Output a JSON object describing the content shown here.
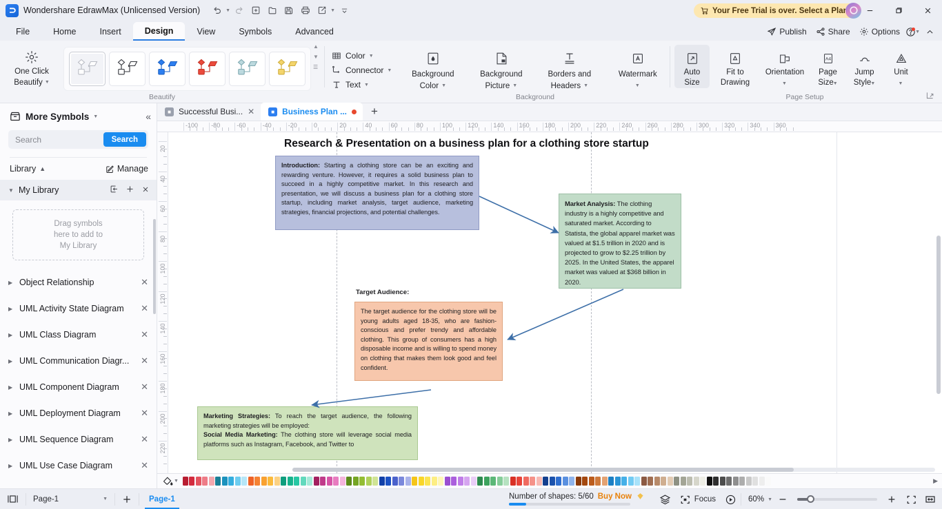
{
  "app": {
    "title": "Wondershare EdrawMax (Unlicensed Version)",
    "logo_glyph": "ɔ",
    "trial_banner": "Your Free Trial is over. Select a Plan"
  },
  "quick_access": [
    {
      "name": "undo",
      "icon": "undo-icon",
      "has_caret": true
    },
    {
      "name": "redo",
      "icon": "redo-icon",
      "has_caret": false
    },
    {
      "name": "new",
      "icon": "new-file-icon",
      "has_caret": false
    },
    {
      "name": "open",
      "icon": "folder-open-icon",
      "has_caret": false
    },
    {
      "name": "save",
      "icon": "save-icon",
      "has_caret": false
    },
    {
      "name": "print",
      "icon": "print-icon",
      "has_caret": false
    },
    {
      "name": "export",
      "icon": "export-icon",
      "has_caret": true
    },
    {
      "name": "more",
      "icon": "chevron-down-icon",
      "has_caret": false
    }
  ],
  "window_buttons": {
    "minimize": "–",
    "maximize": "❐",
    "close": "✕"
  },
  "menu": {
    "tabs": [
      {
        "label": "File",
        "active": false
      },
      {
        "label": "Home",
        "active": false
      },
      {
        "label": "Insert",
        "active": false
      },
      {
        "label": "Design",
        "active": true
      },
      {
        "label": "View",
        "active": false
      },
      {
        "label": "Symbols",
        "active": false
      },
      {
        "label": "Advanced",
        "active": false
      }
    ],
    "right_links": [
      {
        "label": "Publish",
        "icon": "publish-icon"
      },
      {
        "label": "Share",
        "icon": "share-icon"
      },
      {
        "label": "Options",
        "icon": "gear-icon"
      }
    ]
  },
  "ribbon": {
    "groups": [
      {
        "name": "beautify",
        "label": "Beautify"
      },
      {
        "name": "background",
        "label": "Background"
      },
      {
        "name": "page_setup",
        "label": "Page Setup"
      }
    ],
    "one_click_beautify": {
      "line1": "One Click",
      "line2": "Beautify"
    },
    "theme_swatches": [
      {
        "name": "theme-default",
        "selected": true,
        "fill": "#ffffff",
        "stroke": "#b9bcc4"
      },
      {
        "name": "theme-outline",
        "selected": false,
        "fill": "#ffffff",
        "stroke": "#33353b"
      },
      {
        "name": "theme-blue",
        "selected": false,
        "fill": "#2d7ff0",
        "stroke": "#1c62c4"
      },
      {
        "name": "theme-red",
        "selected": false,
        "fill": "#eb4b3c",
        "stroke": "#c43326"
      },
      {
        "name": "theme-teal",
        "selected": false,
        "fill": "#bcd9de",
        "stroke": "#7fa9b1"
      },
      {
        "name": "theme-yellow",
        "selected": false,
        "fill": "#f3d46b",
        "stroke": "#cfae3d"
      }
    ],
    "mini_items": [
      {
        "label": "Color",
        "icon": "color-grid-icon",
        "caret": true
      },
      {
        "label": "Connector",
        "icon": "connector-icon",
        "caret": true
      },
      {
        "label": "Text",
        "icon": "text-icon",
        "caret": true
      }
    ],
    "background_buttons": [
      {
        "l1": "Background",
        "l2": "Color",
        "icon": "paint-drop-icon",
        "caret": true
      },
      {
        "l1": "Background",
        "l2": "Picture",
        "icon": "picture-page-icon",
        "caret": true
      },
      {
        "l1": "Borders and",
        "l2": "Headers",
        "icon": "borders-headers-icon",
        "caret": true
      },
      {
        "l1": "Watermark",
        "l2": "",
        "icon": "watermark-icon",
        "caret": true
      }
    ],
    "page_setup_buttons": [
      {
        "l1": "Auto",
        "l2": "Size",
        "icon": "auto-size-icon",
        "caret": false,
        "selected": true
      },
      {
        "l1": "Fit to",
        "l2": "Drawing",
        "icon": "fit-to-drawing-icon",
        "caret": false,
        "selected": false
      },
      {
        "l1": "Orientation",
        "l2": "",
        "icon": "orientation-icon",
        "caret": true,
        "selected": false
      },
      {
        "l1": "Page",
        "l2": "Size",
        "icon": "page-size-icon",
        "caret": true,
        "selected": false
      },
      {
        "l1": "Jump",
        "l2": "Style",
        "icon": "jump-style-icon",
        "caret": true,
        "selected": false
      },
      {
        "l1": "Unit",
        "l2": "",
        "icon": "unit-icon",
        "caret": true,
        "selected": false
      }
    ]
  },
  "sidebar": {
    "title": "More Symbols",
    "search_placeholder": "Search",
    "search_value": "",
    "search_button": "Search",
    "library_label": "Library",
    "manage_label": "Manage",
    "my_library_label": "My Library",
    "dropzone": [
      "Drag symbols",
      "here to add to",
      "My Library"
    ],
    "items": [
      {
        "label": "Object Relationship"
      },
      {
        "label": "UML Activity State Diagram"
      },
      {
        "label": "UML Class Diagram"
      },
      {
        "label": "UML Communication Diagr..."
      },
      {
        "label": "UML Component Diagram"
      },
      {
        "label": "UML Deployment Diagram"
      },
      {
        "label": "UML Sequence Diagram"
      },
      {
        "label": "UML Use Case Diagram"
      }
    ]
  },
  "doc_tabs": [
    {
      "label": "Successful Busi...",
      "active": false,
      "modified": false
    },
    {
      "label": "Business Plan ...",
      "active": true,
      "modified": true
    }
  ],
  "rulers": {
    "horizontal": [
      "-100",
      "-80",
      "-60",
      "-40",
      "-20",
      "0",
      "20",
      "40",
      "60",
      "80",
      "100",
      "120",
      "140",
      "160",
      "180",
      "200",
      "220",
      "240",
      "260",
      "280",
      "300",
      "320",
      "340",
      "360"
    ],
    "vertical": [
      "20",
      "40",
      "60",
      "80",
      "100",
      "120",
      "140",
      "160",
      "180",
      "200",
      "220"
    ]
  },
  "canvas": {
    "title": "Research & Presentation on a business plan for a clothing store startup",
    "shapes": [
      {
        "name": "introduction-shape",
        "heading": "Introduction:",
        "text": " Starting a clothing store can be an exciting and rewarding venture. However, it requires a solid business plan to succeed in a highly competitive market. In this research and presentation, we will discuss a business plan for a clothing store startup, including market analysis, target audience, marketing strategies, financial projections, and potential challenges."
      },
      {
        "name": "market-analysis-shape",
        "heading": "Market Analysis:",
        "text": " The clothing industry is a highly competitive and saturated market. According to Statista, the global apparel market was valued at $1.5 trillion in 2020 and is projected to grow to $2.25 trillion by 2025. In the United States, the apparel market was valued at $368 billion in 2020."
      },
      {
        "name": "target-audience-shape",
        "label": "Target Audience:",
        "heading": "",
        "text": "The target audience for the clothing store will be young adults aged 18-35, who are fashion-conscious and prefer trendy and affordable clothing. This group of consumers has a high disposable income and is willing to spend money on clothing that makes them look good and feel confident."
      },
      {
        "name": "marketing-strategies-shape",
        "heading": "Marketing Strategies:",
        "text": " To reach the target audience, the following marketing strategies will be employed:",
        "heading2": "Social Media Marketing:",
        "text2": " The clothing store will leverage social media platforms such as Instagram, Facebook, and Twitter to"
      }
    ]
  },
  "palette": {
    "colors": [
      "#b81d31",
      "#d32b3e",
      "#e4545f",
      "#ee7c87",
      "#f3a8ae",
      "#1a7f96",
      "#1c92bd",
      "#35aede",
      "#6ecdf0",
      "#b6e6f7",
      "#ef6226",
      "#f58233",
      "#f9a130",
      "#fbba3c",
      "#fcd182",
      "#0f9e7e",
      "#17b38d",
      "#27c7a4",
      "#62d9bd",
      "#a5ead9",
      "#a32060",
      "#c03a8a",
      "#d755a6",
      "#e87cc0",
      "#f4b4dc",
      "#5e8a1b",
      "#75a524",
      "#93bd33",
      "#b0d15a",
      "#d0e495",
      "#1140a8",
      "#1c52c4",
      "#4b62cc",
      "#7a88db",
      "#a9b2ea",
      "#f5c518",
      "#f9d628",
      "#fbe452",
      "#fdee83",
      "#fef6b8",
      "#9a4fd1",
      "#ab5fdd",
      "#c07ee8",
      "#d6a5f0",
      "#e9cdf7",
      "#2e8b4f",
      "#3da35e",
      "#5cb878",
      "#86cd9a",
      "#b6e2c1",
      "#d93025",
      "#e8443a",
      "#f06a60",
      "#f59289",
      "#f8b9b3",
      "#14408f",
      "#1b52ad",
      "#2f6fd0",
      "#5a90e0",
      "#8fb4ec",
      "#8a3a0b",
      "#a4480f",
      "#bb5c1d",
      "#cf7a3c",
      "#e3a273",
      "#1b7fc4",
      "#2a95d6",
      "#45b0e8",
      "#72cbf3",
      "#a8e2fa",
      "#8c5a43",
      "#a06e52",
      "#b78a6a",
      "#cfae90",
      "#e2cbb4",
      "#8e9184",
      "#a3a596",
      "#bcbdb0",
      "#d6d6cb",
      "#eeeee6",
      "#111111",
      "#2e2e2e",
      "#4c4c4c",
      "#6d6d6d",
      "#8f8f8f",
      "#adadad",
      "#c9c9c9",
      "#e0e0e0",
      "#eeeeee",
      "#fafafa"
    ]
  },
  "status": {
    "page_select": "Page-1",
    "page_tab": "Page-1",
    "shapes_label": "Number of shapes: 5/60",
    "buy_now": "Buy Now",
    "focus_label": "Focus",
    "zoom_level": "60%"
  }
}
